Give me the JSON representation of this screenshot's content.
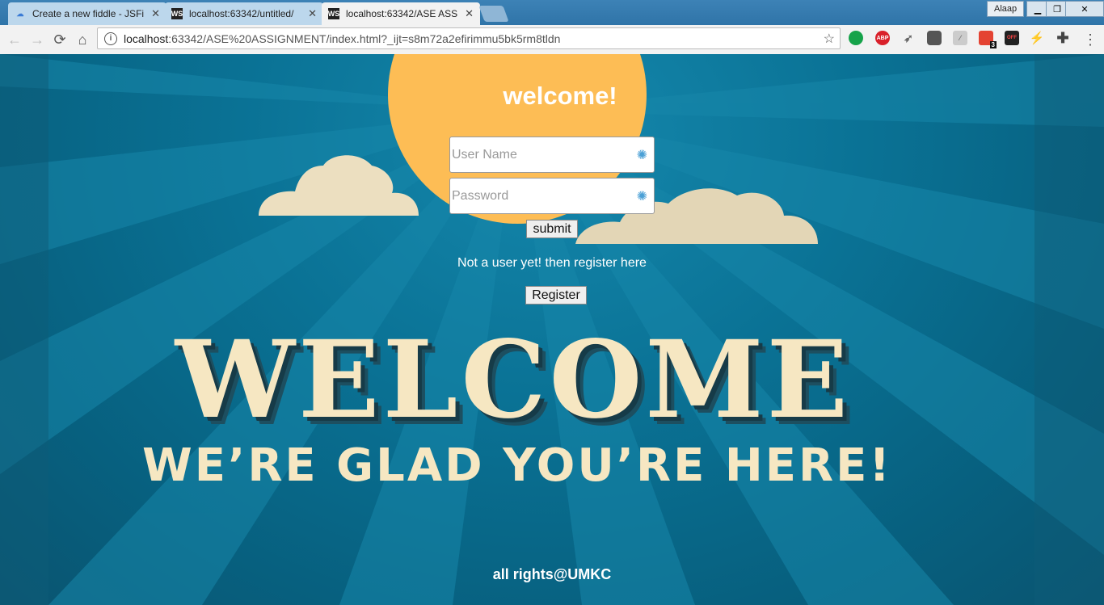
{
  "browser": {
    "tabs": [
      {
        "title": "Create a new fiddle - JSFi",
        "icon": "cloud-icon"
      },
      {
        "title": "localhost:63342/untitled/",
        "icon": "ws-icon"
      },
      {
        "title": "localhost:63342/ASE ASS",
        "icon": "ws-icon"
      }
    ],
    "profile": "Alaap",
    "url_host": "localhost",
    "url_rest": ":63342/ASE%20ASSIGNMENT/index.html?_ijt=s8m72a2efirimmu5bk5rm8tldn",
    "extensions": [
      "grammarly-icon",
      "adblock-icon",
      "rocket-icon",
      "pocket-icon",
      "pdf-icon",
      "todoist-icon",
      "off-icon",
      "lightning-icon",
      "plus-icon"
    ],
    "todoist_badge": "3",
    "abp_label": "ABP",
    "off_label": "OFF"
  },
  "page": {
    "heading": "welcome!",
    "username_placeholder": "User Name",
    "password_placeholder": "Password",
    "submit_label": "submit",
    "register_note": "Not a user yet! then register here",
    "register_label": "Register",
    "banner_title": "WELCOME",
    "banner_subtitle": "WE’RE GLAD YOU’RE HERE!",
    "footer": "all rights@UMKC"
  },
  "colors": {
    "background": "#0b6f8f",
    "sun": "#fdbd55",
    "cream": "#f6e7c2"
  }
}
